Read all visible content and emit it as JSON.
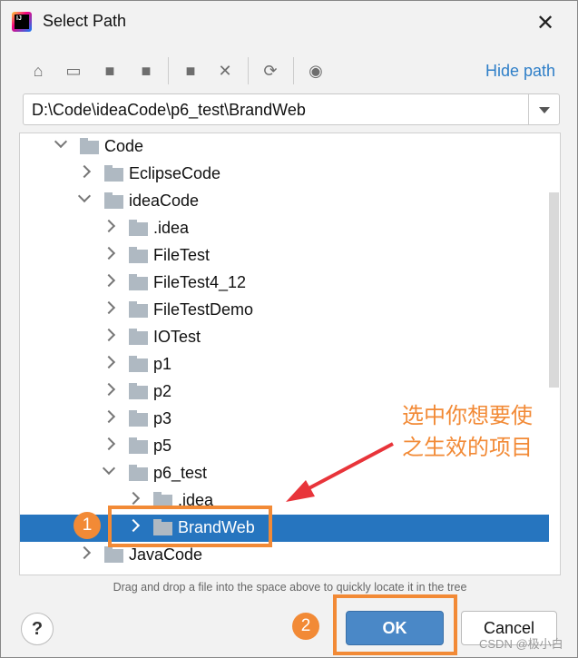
{
  "window": {
    "title": "Select Path",
    "logo_text": "IJ"
  },
  "toolbar": {
    "icons": [
      "home-icon",
      "desktop-icon",
      "project-folder-icon",
      "module-folder-icon",
      "new-folder-icon",
      "delete-icon",
      "refresh-icon",
      "show-hidden-icon"
    ],
    "hide_path_label": "Hide path"
  },
  "path_field": {
    "value": "D:\\Code\\ideaCode\\p6_test\\BrandWeb"
  },
  "tree": {
    "rows": [
      {
        "label": "Code",
        "level": 0,
        "expanded": true
      },
      {
        "label": "EclipseCode",
        "level": 1,
        "expanded": false
      },
      {
        "label": "ideaCode",
        "level": 1,
        "expanded": true
      },
      {
        "label": ".idea",
        "level": 2,
        "expanded": false
      },
      {
        "label": "FileTest",
        "level": 2,
        "expanded": false
      },
      {
        "label": "FileTest4_12",
        "level": 2,
        "expanded": false
      },
      {
        "label": "FileTestDemo",
        "level": 2,
        "expanded": false
      },
      {
        "label": "IOTest",
        "level": 2,
        "expanded": false
      },
      {
        "label": "p1",
        "level": 2,
        "expanded": false
      },
      {
        "label": "p2",
        "level": 2,
        "expanded": false
      },
      {
        "label": "p3",
        "level": 2,
        "expanded": false
      },
      {
        "label": "p5",
        "level": 2,
        "expanded": false
      },
      {
        "label": "p6_test",
        "level": 2,
        "expanded": true
      },
      {
        "label": ".idea",
        "level": 3,
        "expanded": false
      },
      {
        "label": "BrandWeb",
        "level": 3,
        "expanded": false,
        "selected": true
      },
      {
        "label": "JavaCode",
        "level": 1,
        "expanded": false
      }
    ]
  },
  "hint": "Drag and drop a file into the space above to quickly locate it in the tree",
  "buttons": {
    "help": "?",
    "ok": "OK",
    "cancel": "Cancel"
  },
  "annotations": {
    "note_line1": "选中你想要使",
    "note_line2": "之生效的项目",
    "step1": "1",
    "step2": "2",
    "color": "#f28a36",
    "arrow_color": "#e8343a"
  },
  "watermark": "CSDN @极小白"
}
